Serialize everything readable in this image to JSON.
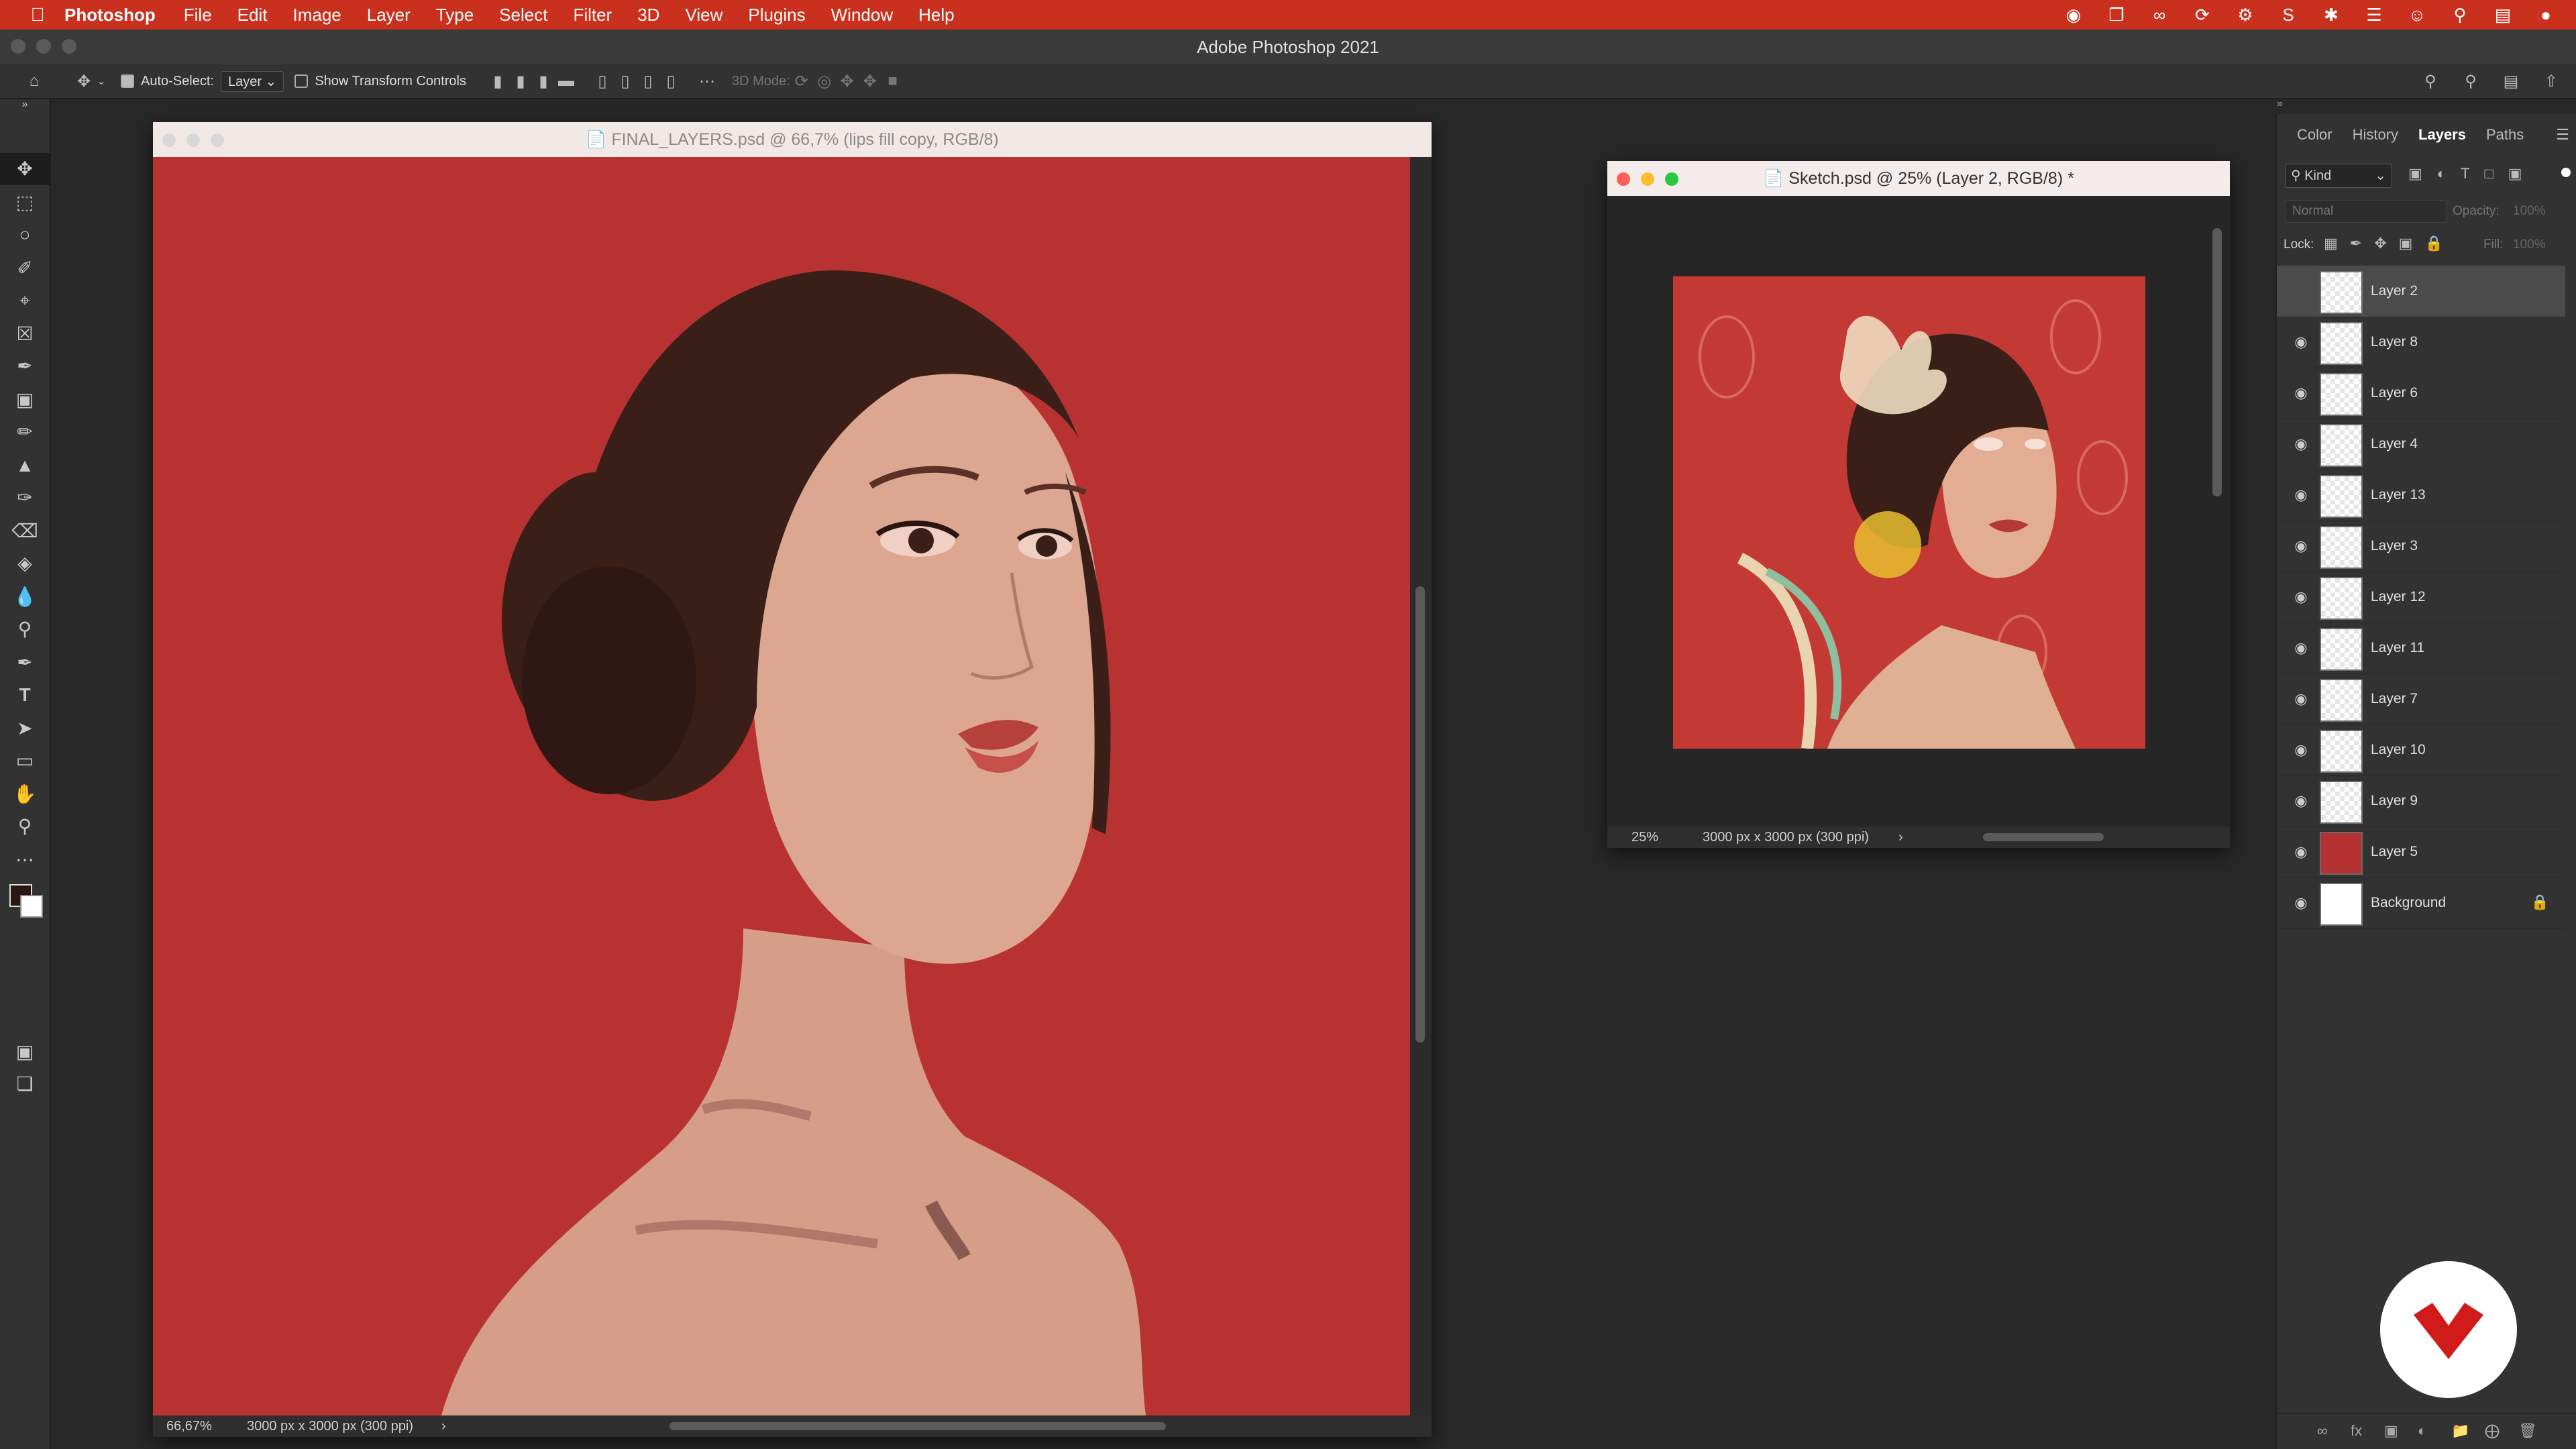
{
  "menubar": {
    "app_name": "Photoshop",
    "items": [
      "File",
      "Edit",
      "Image",
      "Layer",
      "Type",
      "Select",
      "Filter",
      "3D",
      "View",
      "Plugins",
      "Window",
      "Help"
    ]
  },
  "app_title": "Adobe Photoshop 2021",
  "options_bar": {
    "auto_select_label": "Auto-Select:",
    "auto_select_value": "Layer",
    "show_transform_label": "Show Transform Controls",
    "mode_3d_label": "3D Mode:"
  },
  "doc_main": {
    "title": "FINAL_LAYERS.psd @ 66,7% (lips fill copy, RGB/8)",
    "zoom": "66,67%",
    "info": "3000 px x 3000 px (300 ppi)"
  },
  "doc_sketch": {
    "title": "Sketch.psd @ 25% (Layer 2, RGB/8) *",
    "zoom": "25%",
    "info": "3000 px x 3000 px (300 ppi)"
  },
  "panel": {
    "tabs": [
      "Color",
      "History",
      "Layers",
      "Paths"
    ],
    "active_tab": "Layers",
    "filter_label": "Kind",
    "blend_mode": "Normal",
    "opacity_label": "Opacity:",
    "opacity_value": "100%",
    "lock_label": "Lock:",
    "fill_label": "Fill:",
    "fill_value": "100%",
    "layers": [
      {
        "name": "Layer 2",
        "selected": true,
        "visible": false
      },
      {
        "name": "Layer 8",
        "visible": true
      },
      {
        "name": "Layer 6",
        "visible": true
      },
      {
        "name": "Layer 4",
        "visible": true
      },
      {
        "name": "Layer 13",
        "visible": true
      },
      {
        "name": "Layer 3",
        "visible": true
      },
      {
        "name": "Layer 12",
        "visible": true
      },
      {
        "name": "Layer 11",
        "visible": true
      },
      {
        "name": "Layer 7",
        "visible": true
      },
      {
        "name": "Layer 10",
        "visible": true
      },
      {
        "name": "Layer 9",
        "visible": true
      },
      {
        "name": "Layer 5",
        "visible": true,
        "thumb_color": "#b53030"
      },
      {
        "name": "Background",
        "visible": true,
        "locked": true,
        "thumb_color": "#ffffff"
      }
    ]
  },
  "colors": {
    "menubar": "#c9301d",
    "canvas_red": "#b73230",
    "skin": "#d8a18a",
    "hair": "#3a1f18"
  }
}
